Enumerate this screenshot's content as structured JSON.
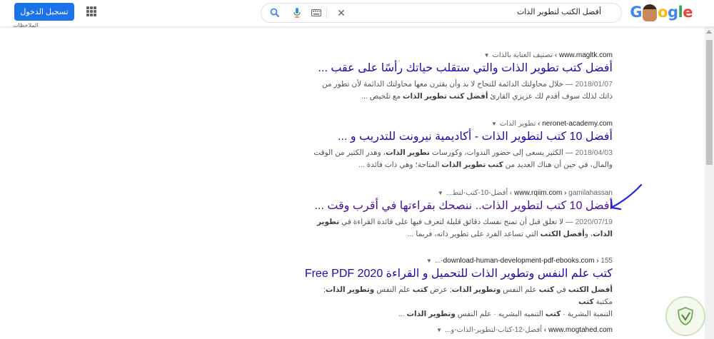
{
  "header": {
    "search_query": "أفضل الكتب لتطوير الذات",
    "signin_label": "تسجيل الدخول",
    "notes_label": "الملاحظات",
    "logo_text": "Google"
  },
  "results": [
    {
      "site": "www.magltk.com",
      "path": "تصنيف العناية بالذات",
      "title": "أفضل كتب تطوير الذات والتي ستقلب حياتك رأسًا على عقب ...",
      "date": "2018/01/07",
      "snippet_1": "خلال محاولتك الدائمة للنجاح لا بد وأن يقترن معها محاولتك الدائمة لأن تطور من",
      "snippet_2a": "ذاتك لذلك سوف أقدم لك عزيزي القارئ ",
      "snippet_2b": "أفضل كتب تطوير الذات",
      "snippet_2c": " مع تلخيص ...",
      "visited": false
    },
    {
      "site": "neronet-academy.com",
      "path": "تطوير الذات",
      "title": "أفضل 10 كتب لتطوير الذات - أكاديمية نيرونت للتدريب و ...",
      "date": "2018/04/03",
      "snippet_1a": "الكثير يسعى إلى حضور الندوات، وكورسات ",
      "snippet_1b": "تطوير الذات",
      "snippet_1c": "، وهدر الكثير من الوقت",
      "snippet_2a": "والمال، في حين أن هناك العديد من ",
      "snippet_2b": "كتب تطوير الذات",
      "snippet_2c": " المتاحة؛ وهي ذات فائدة ...",
      "visited": false
    },
    {
      "site": "www.rqiim.com",
      "path": "gamilahassan › أفضل-10-كتب-لتط...",
      "title": "أفضل 10 كتب لتطوير الذات.. ننصحك بقراءتها في أقرب وقت ...",
      "date": "2020/07/19",
      "snippet_1a": "لا تغلق قبل أن تمنح نفسك دقائق قليلة لتعرف فيها على فائدة القراءة في ",
      "snippet_1b": "تطوير",
      "snippet_2a": "الذات",
      "snippet_2b": "، و",
      "snippet_2c": "أفضل الكتب",
      "snippet_2d": " التي تساعد الفرد على تطوير ذاته، فربما ...",
      "visited": true
    },
    {
      "site": "download-human-development-pdf-ebooks.com",
      "path": "155-...",
      "title": "كتب علم النفس وتطوير الذات للتحميل و القراءة 2020 Free PDF",
      "snippet_1a": "أفضل الكتب",
      "snippet_1b": " في ",
      "snippet_1c": "كتب",
      "snippet_1d": " علم النفس ",
      "snippet_1e": "وتطوير الذات",
      "snippet_1f": "; عرض ",
      "snippet_1g": "كتب",
      "snippet_1h": " علم النفس ",
      "snippet_1i": "وتطوير الذات",
      "snippet_1j": "; مكتبة ",
      "snippet_1k": "كتب",
      "snippet_2a": "التنمية البشرية · ",
      "snippet_2b": "كتب",
      "snippet_2c": " التنميه البشريه · علم النفس ",
      "snippet_2d": "وتطوير الذات",
      "snippet_2e": " ...",
      "visited": false
    },
    {
      "site": "www.mogtahed.com",
      "path": "أفضل-12-كتاب-لتطوير-الذات-و...",
      "visited": false
    }
  ],
  "colors": {
    "link": "#1a0dab",
    "visited": "#4b0f9b",
    "accent": "#1a73e8",
    "annotation": "#1e2bd6"
  }
}
